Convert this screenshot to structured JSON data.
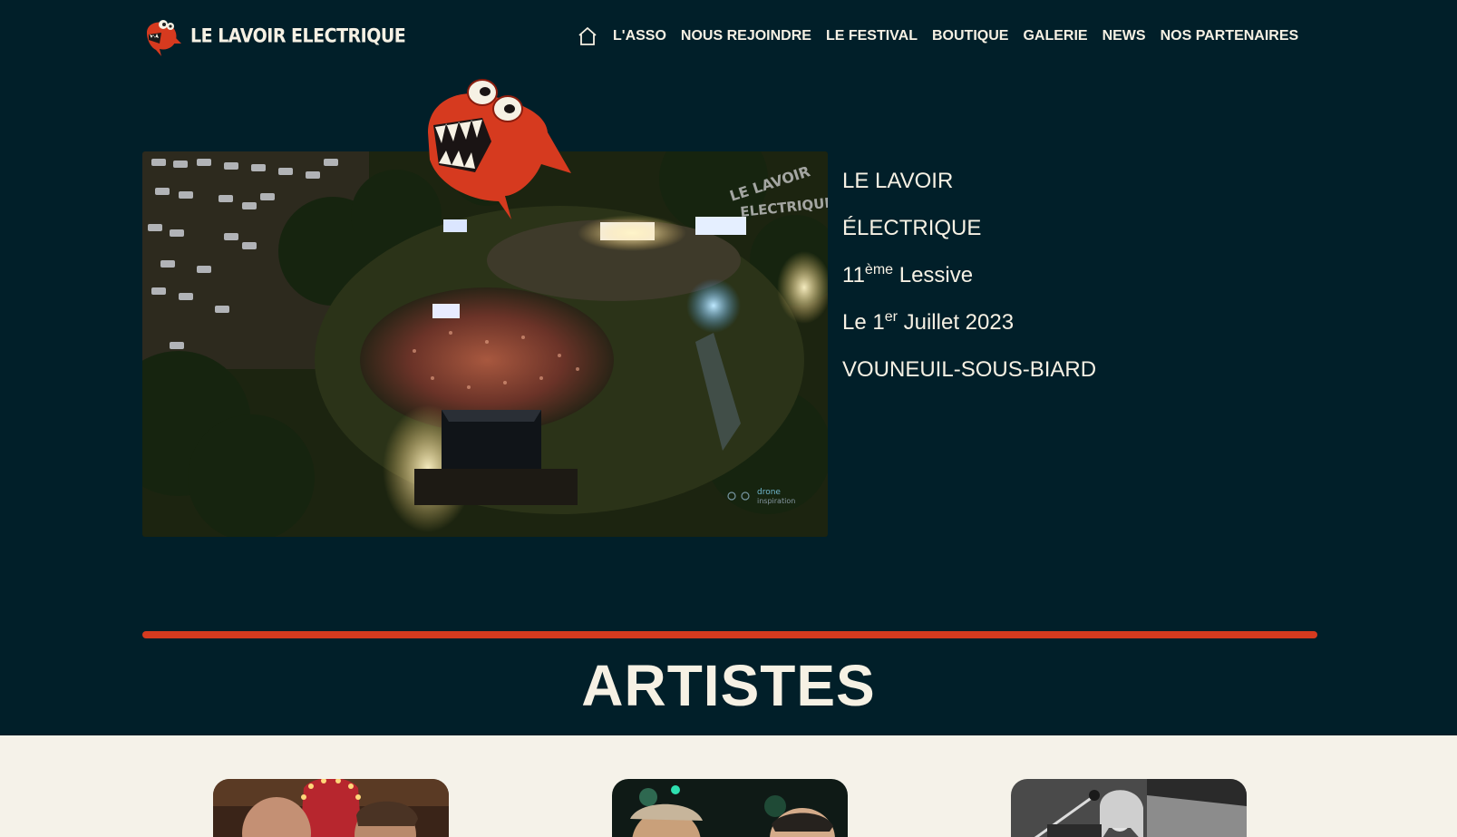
{
  "brand": {
    "name": "LE LAVOIR ELECTRIQUE",
    "logo_icon": "red-piranha-mascot-icon"
  },
  "nav": {
    "home_icon": "home-icon",
    "items": [
      {
        "label": "L'ASSO"
      },
      {
        "label": "NOUS REJOINDRE"
      },
      {
        "label": "LE FESTIVAL"
      },
      {
        "label": "BOUTIQUE"
      },
      {
        "label": "GALERIE"
      },
      {
        "label": "NEWS"
      },
      {
        "label": "NOS PARTENAIRES"
      }
    ]
  },
  "hero": {
    "photo_watermark": "LE LAVOIR ELECTRIQUE",
    "photo_credit": "drone inspiration",
    "line1": "LE LAVOIR",
    "line2": "ÉLECTRIQUE",
    "edition_number": "11",
    "edition_suffix": "ème",
    "edition_word": " Lessive",
    "date_prefix": "Le 1",
    "date_suffix": "er",
    "date_rest": " Juillet 2023",
    "place": "VOUNEUIL-SOUS-BIARD"
  },
  "artists": {
    "title": "ARTISTES",
    "cards": [
      {
        "photo": "artist-duo-photo"
      },
      {
        "photo": "artist-band-photo"
      },
      {
        "photo": "artist-singer-bw-photo"
      }
    ]
  },
  "colors": {
    "background": "#011f29",
    "accent": "#d63a1f",
    "cream": "#f5f2e9"
  }
}
